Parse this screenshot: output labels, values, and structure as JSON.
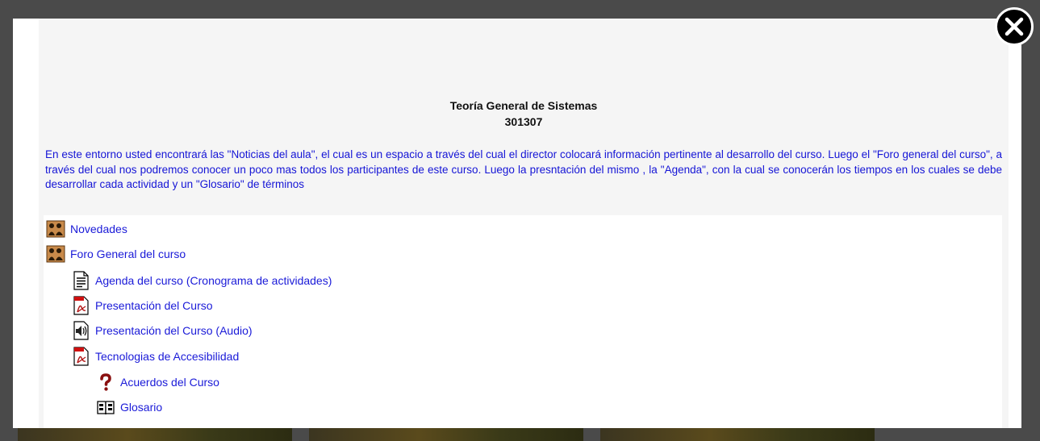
{
  "course": {
    "title": "Teoría General de Sistemas",
    "code": "301307"
  },
  "description": "En este entorno usted encontrará las \"Noticias del aula\", el cual es un espacio a través del cual el director colocará información pertinente al desarrollo del curso. Luego el \"Foro general del curso\", a través del cual nos podremos conocer un poco mas todos los participantes de este curso. Luego la presntación del mismo , la \"Agenda\", con la cual se conocerán los tiempos en los cuales se debe desarrollar cada actividad y un \"Glosario\" de términos",
  "resources": [
    {
      "label": "Novedades",
      "icon": "forum-icon"
    },
    {
      "label": "Foro General del curso",
      "icon": "forum-icon"
    },
    {
      "label": "Agenda del curso (Cronograma de actividades)",
      "icon": "text-document-icon"
    },
    {
      "label": "Presentación del Curso",
      "icon": "pdf-icon"
    },
    {
      "label": "Presentación del Curso (Audio)",
      "icon": "audio-file-icon"
    },
    {
      "label": "Tecnologias de Accesibilidad",
      "icon": "pdf-icon"
    },
    {
      "label": "Acuerdos del Curso",
      "icon": "question-mark-icon"
    },
    {
      "label": "Glosario",
      "icon": "glossary-book-icon"
    }
  ],
  "colors": {
    "link": "#1a1ad8",
    "description": "#1515d6",
    "panel_bg": "#f5f5f5",
    "overlay": "#4a4a4a"
  }
}
